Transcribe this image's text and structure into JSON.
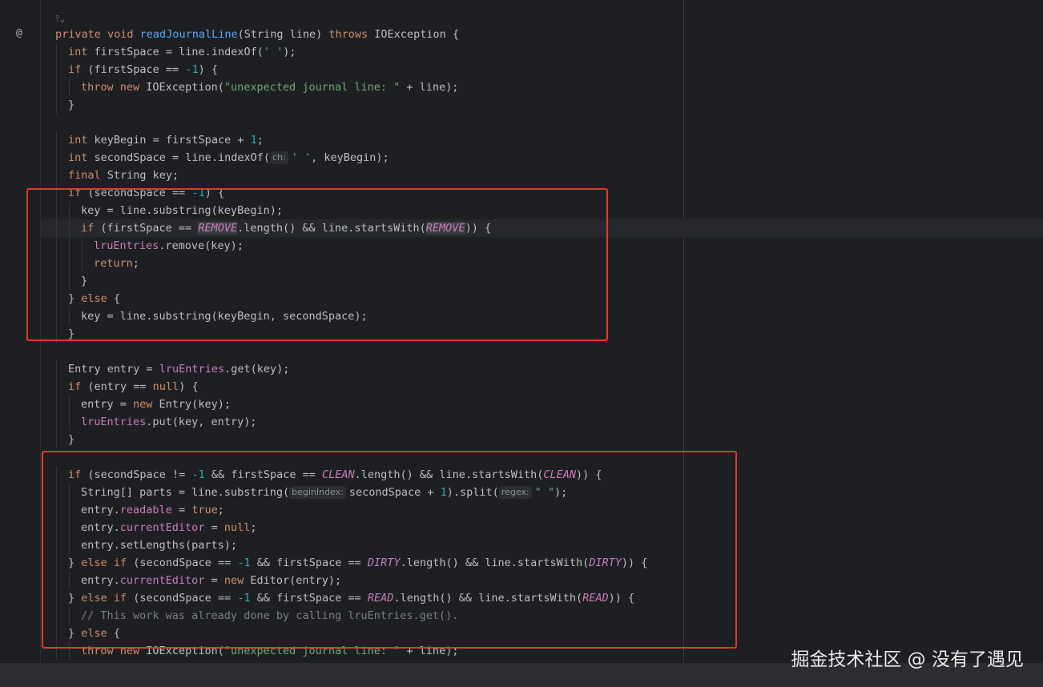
{
  "gutter": {
    "annotation_symbol": "@"
  },
  "editor": {
    "inlay_top": "⫯⌄",
    "lines": [
      {
        "indent": 0,
        "parts": [
          {
            "t": "private ",
            "c": "kw"
          },
          {
            "t": "void ",
            "c": "kw"
          },
          {
            "t": "readJournalLine",
            "c": "fn"
          },
          {
            "t": "(String line) "
          },
          {
            "t": "throws ",
            "c": "kw"
          },
          {
            "t": "IOException {"
          }
        ]
      },
      {
        "indent": 1,
        "parts": [
          {
            "t": "int ",
            "c": "kw"
          },
          {
            "t": "firstSpace = line.indexOf("
          },
          {
            "t": "' '",
            "c": "str"
          },
          {
            "t": ");"
          }
        ]
      },
      {
        "indent": 1,
        "parts": [
          {
            "t": "if ",
            "c": "kw"
          },
          {
            "t": "(firstSpace == "
          },
          {
            "t": "-1",
            "c": "num"
          },
          {
            "t": ") {"
          }
        ]
      },
      {
        "indent": 2,
        "parts": [
          {
            "t": "throw ",
            "c": "kw"
          },
          {
            "t": "new ",
            "c": "kw"
          },
          {
            "t": "IOException("
          },
          {
            "t": "\"unexpected journal line: \"",
            "c": "str"
          },
          {
            "t": " + line);"
          }
        ]
      },
      {
        "indent": 1,
        "parts": [
          {
            "t": "}"
          }
        ]
      },
      {
        "indent": 0,
        "parts": []
      },
      {
        "indent": 1,
        "parts": [
          {
            "t": "int ",
            "c": "kw"
          },
          {
            "t": "keyBegin = firstSpace + "
          },
          {
            "t": "1",
            "c": "num"
          },
          {
            "t": ";"
          }
        ]
      },
      {
        "indent": 1,
        "parts": [
          {
            "t": "int ",
            "c": "kw"
          },
          {
            "t": "secondSpace = line.indexOf("
          },
          {
            "t": "ch:",
            "c": "hint"
          },
          {
            "t": "' '",
            "c": "str"
          },
          {
            "t": ", keyBegin);"
          }
        ]
      },
      {
        "indent": 1,
        "parts": [
          {
            "t": "final ",
            "c": "kw"
          },
          {
            "t": "String key;"
          }
        ]
      },
      {
        "indent": 1,
        "parts": [
          {
            "t": "if ",
            "c": "kw"
          },
          {
            "t": "(secondSpace == "
          },
          {
            "t": "-1",
            "c": "num"
          },
          {
            "t": ") {"
          }
        ]
      },
      {
        "indent": 2,
        "parts": [
          {
            "t": "key = line.substring(keyBegin);"
          }
        ]
      },
      {
        "indent": 2,
        "current": true,
        "parts": [
          {
            "t": "if ",
            "c": "kw"
          },
          {
            "t": "(firstSpace == "
          },
          {
            "t": "REMOVE",
            "c": "const-hl"
          },
          {
            "t": ".length() && line.startsWith("
          },
          {
            "t": "REMOVE",
            "c": "const-hl"
          },
          {
            "t": ")) {"
          }
        ]
      },
      {
        "indent": 3,
        "parts": [
          {
            "t": "lruEntries",
            "c": "field"
          },
          {
            "t": ".remove(key);"
          }
        ]
      },
      {
        "indent": 3,
        "parts": [
          {
            "t": "return",
            "c": "kw"
          },
          {
            "t": ";"
          }
        ]
      },
      {
        "indent": 2,
        "parts": [
          {
            "t": "}"
          }
        ]
      },
      {
        "indent": 1,
        "parts": [
          {
            "t": "} "
          },
          {
            "t": "else ",
            "c": "kw"
          },
          {
            "t": "{"
          }
        ]
      },
      {
        "indent": 2,
        "parts": [
          {
            "t": "key = line.substring(keyBegin, secondSpace);"
          }
        ]
      },
      {
        "indent": 1,
        "parts": [
          {
            "t": "}"
          }
        ]
      },
      {
        "indent": 0,
        "parts": []
      },
      {
        "indent": 1,
        "parts": [
          {
            "t": "Entry entry = "
          },
          {
            "t": "lruEntries",
            "c": "field"
          },
          {
            "t": ".get(key);"
          }
        ]
      },
      {
        "indent": 1,
        "parts": [
          {
            "t": "if ",
            "c": "kw"
          },
          {
            "t": "(entry == "
          },
          {
            "t": "null",
            "c": "kw"
          },
          {
            "t": ") {"
          }
        ]
      },
      {
        "indent": 2,
        "parts": [
          {
            "t": "entry = "
          },
          {
            "t": "new ",
            "c": "kw"
          },
          {
            "t": "Entry(key);"
          }
        ]
      },
      {
        "indent": 2,
        "parts": [
          {
            "t": "lruEntries",
            "c": "field"
          },
          {
            "t": ".put(key, entry);"
          }
        ]
      },
      {
        "indent": 1,
        "parts": [
          {
            "t": "}"
          }
        ]
      },
      {
        "indent": 0,
        "parts": []
      },
      {
        "indent": 1,
        "parts": [
          {
            "t": "if ",
            "c": "kw"
          },
          {
            "t": "(secondSpace != "
          },
          {
            "t": "-1",
            "c": "num"
          },
          {
            "t": " && firstSpace == "
          },
          {
            "t": "CLEAN",
            "c": "const"
          },
          {
            "t": ".length() && line.startsWith("
          },
          {
            "t": "CLEAN",
            "c": "const"
          },
          {
            "t": ")) {"
          }
        ]
      },
      {
        "indent": 2,
        "parts": [
          {
            "t": "String[] parts = line.substring("
          },
          {
            "t": "beginIndex:",
            "c": "hint"
          },
          {
            "t": "secondSpace + "
          },
          {
            "t": "1",
            "c": "num"
          },
          {
            "t": ").split("
          },
          {
            "t": "regex:",
            "c": "hint"
          },
          {
            "t": "\" \"",
            "c": "str"
          },
          {
            "t": ");"
          }
        ]
      },
      {
        "indent": 2,
        "parts": [
          {
            "t": "entry."
          },
          {
            "t": "readable",
            "c": "field"
          },
          {
            "t": " = "
          },
          {
            "t": "true",
            "c": "kw"
          },
          {
            "t": ";"
          }
        ]
      },
      {
        "indent": 2,
        "parts": [
          {
            "t": "entry."
          },
          {
            "t": "currentEditor",
            "c": "field"
          },
          {
            "t": " = "
          },
          {
            "t": "null",
            "c": "kw"
          },
          {
            "t": ";"
          }
        ]
      },
      {
        "indent": 2,
        "parts": [
          {
            "t": "entry.setLengths(parts);"
          }
        ]
      },
      {
        "indent": 1,
        "parts": [
          {
            "t": "} "
          },
          {
            "t": "else if ",
            "c": "kw"
          },
          {
            "t": "(secondSpace == "
          },
          {
            "t": "-1",
            "c": "num"
          },
          {
            "t": " && firstSpace == "
          },
          {
            "t": "DIRTY",
            "c": "const"
          },
          {
            "t": ".length() && line.startsWith("
          },
          {
            "t": "DIRTY",
            "c": "const"
          },
          {
            "t": ")) {"
          }
        ]
      },
      {
        "indent": 2,
        "parts": [
          {
            "t": "entry."
          },
          {
            "t": "currentEditor",
            "c": "field"
          },
          {
            "t": " = "
          },
          {
            "t": "new ",
            "c": "kw"
          },
          {
            "t": "Editor(entry);"
          }
        ]
      },
      {
        "indent": 1,
        "parts": [
          {
            "t": "} "
          },
          {
            "t": "else if ",
            "c": "kw"
          },
          {
            "t": "(secondSpace == "
          },
          {
            "t": "-1",
            "c": "num"
          },
          {
            "t": " && firstSpace == "
          },
          {
            "t": "READ",
            "c": "const"
          },
          {
            "t": ".length() && line.startsWith("
          },
          {
            "t": "READ",
            "c": "const"
          },
          {
            "t": ")) {"
          }
        ]
      },
      {
        "indent": 2,
        "parts": [
          {
            "t": "// This work was already done by calling lruEntries.get().",
            "c": "cmt"
          }
        ]
      },
      {
        "indent": 1,
        "parts": [
          {
            "t": "} "
          },
          {
            "t": "else ",
            "c": "kw"
          },
          {
            "t": "{"
          }
        ]
      },
      {
        "indent": 2,
        "parts": [
          {
            "t": "throw ",
            "c": "kw"
          },
          {
            "t": "new ",
            "c": "kw"
          },
          {
            "t": "IOException("
          },
          {
            "t": "\"unexpected journal line: \"",
            "c": "str"
          },
          {
            "t": " + line);"
          }
        ]
      }
    ]
  },
  "highlight_box_color": "#e5372b",
  "watermark": "掘金技术社区 @ 没有了遇见"
}
